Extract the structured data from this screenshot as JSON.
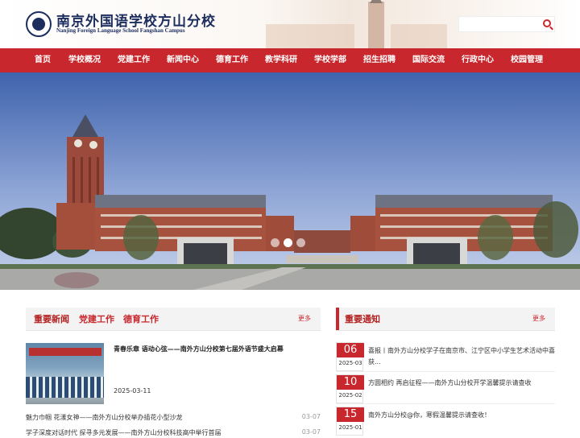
{
  "header": {
    "school_name_cn": "南京外国语学校方山分校",
    "school_name_en": "Nanjing Foreign Language School Fangshan Campus",
    "search_placeholder": "",
    "logo_icon": "school-emblem-icon",
    "search_icon": "search-icon"
  },
  "colors": {
    "brand_red": "#c8282d",
    "navy": "#1c2d5e"
  },
  "nav": {
    "items": [
      "首页",
      "学校概况",
      "党建工作",
      "新闻中心",
      "德育工作",
      "教学科研",
      "学校学部",
      "招生招聘",
      "国际交流",
      "行政中心",
      "校园管理"
    ]
  },
  "banner": {
    "slide_count": 3,
    "active_slide": 2
  },
  "news_panel": {
    "tabs": [
      "重要新闻",
      "党建工作",
      "德育工作"
    ],
    "more": "更多",
    "featured": {
      "title": "青春乐章 语动心弦——南外方山分校第七届外语节盛大启幕",
      "date": "2025-03-11"
    },
    "list": [
      {
        "title": "魅力巾帼 花漾女神——南外方山分校举办插花小型沙龙",
        "date": "03-07"
      },
      {
        "title": "学子深度对话时代 探寻多元发展——南外方山分校科技高中举行首届",
        "date": "03-07"
      }
    ]
  },
  "notice_panel": {
    "title": "重要通知",
    "more": "更多",
    "items": [
      {
        "day": "06",
        "ym": "2025-03",
        "title": "喜报丨南外方山分校学子在南京市、江宁区中小学生艺术活动中喜获..."
      },
      {
        "day": "10",
        "ym": "2025-02",
        "title": "方圆相约 再启征程——南外方山分校开学温馨提示请查收"
      },
      {
        "day": "15",
        "ym": "2025-01",
        "title": "南外方山分校@你，寒假温馨提示请查收！"
      }
    ]
  }
}
